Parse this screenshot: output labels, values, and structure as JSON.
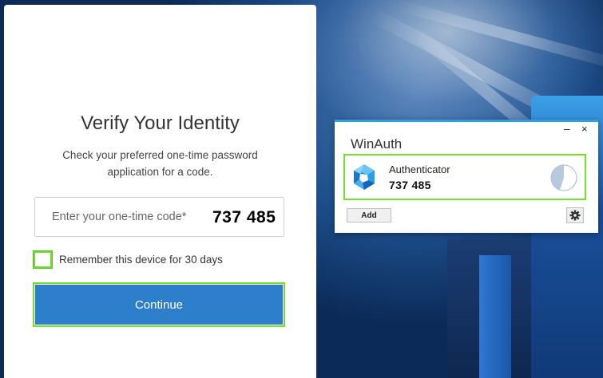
{
  "login": {
    "title": "Verify Your Identity",
    "subtitle": "Check your preferred one-time password application for a code.",
    "otp_placeholder": "Enter your one-time code*",
    "otp_overlay_code": "737 485",
    "remember_label": "Remember this device for 30 days",
    "remember_checked": false,
    "continue_label": "Continue",
    "accent_color": "#2d7fcb",
    "highlight_color": "#74e02e"
  },
  "winauth": {
    "title": "WinAuth",
    "minimize_glyph": "–",
    "close_glyph": "×",
    "entry": {
      "name": "Authenticator",
      "code": "737 485",
      "icon": "authenticator-logo-icon",
      "timer_remaining_fraction": 0.45
    },
    "add_label": "Add",
    "settings_icon": "gear-icon"
  }
}
